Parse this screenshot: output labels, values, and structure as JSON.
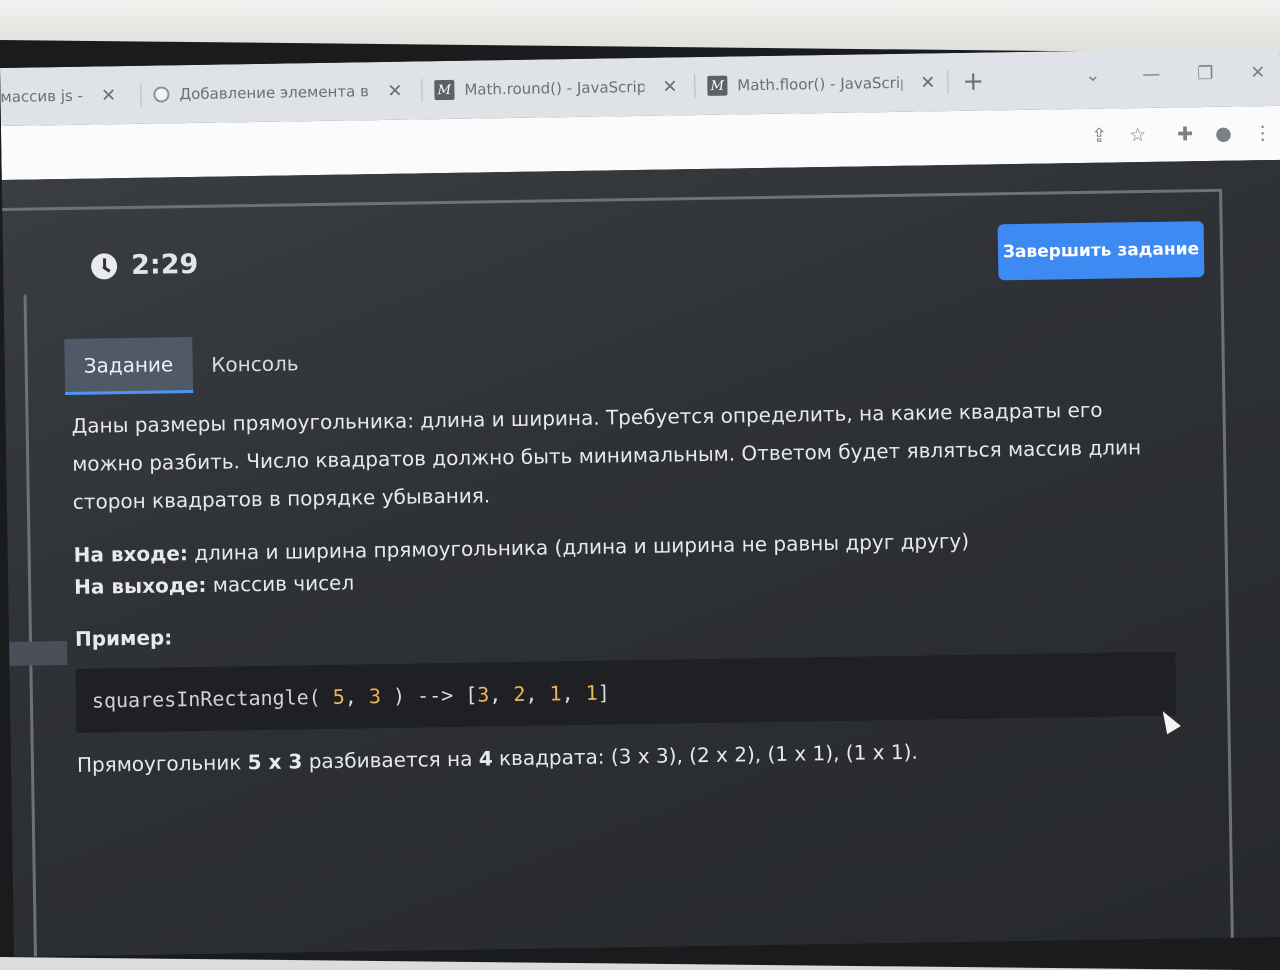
{
  "browser": {
    "tabs": [
      {
        "title": "массив js -",
        "favicon": "none"
      },
      {
        "title": "Добавление элемента в м",
        "favicon": "spiral-icon"
      },
      {
        "title": "Math.round() - JavaScript |",
        "favicon": "mdn-icon"
      },
      {
        "title": "Math.floor() - JavaScript |",
        "favicon": "mdn-icon"
      }
    ],
    "new_tab": "+",
    "close_glyph": "✕"
  },
  "page": {
    "timer": "2:29",
    "finish_button": "Завершить задание",
    "tabs": [
      "Задание",
      "Консоль"
    ],
    "description": "Даны размеры прямоугольника: длина и ширина. Требуется определить, на какие квадраты его можно разбить. Число квадратов должно быть минимальным. Ответом будет являться массив длин сторон квадратов в порядке убывания.",
    "input_label": "На входе:",
    "input_text": "длина и ширина прямоугольника (длина и ширина не равны друг другу)",
    "output_label": "На выходе:",
    "output_text": "массив чисел",
    "example_heading": "Пример:",
    "code": {
      "fn": "squaresInRectangle(",
      "a": "5",
      "comma1": ",",
      "b": "3",
      "tail": ") --> [",
      "r1": "3",
      "r2": "2",
      "r3": "1",
      "r4": "1",
      "close": "]"
    },
    "result": {
      "prefix": "Прямоугольник",
      "dims": "5 x 3",
      "mid": "разбивается на",
      "count": "4",
      "suffix": "квадрата: (3 x 3), (2 x 2), (1 x 1), (1 x 1)."
    }
  }
}
